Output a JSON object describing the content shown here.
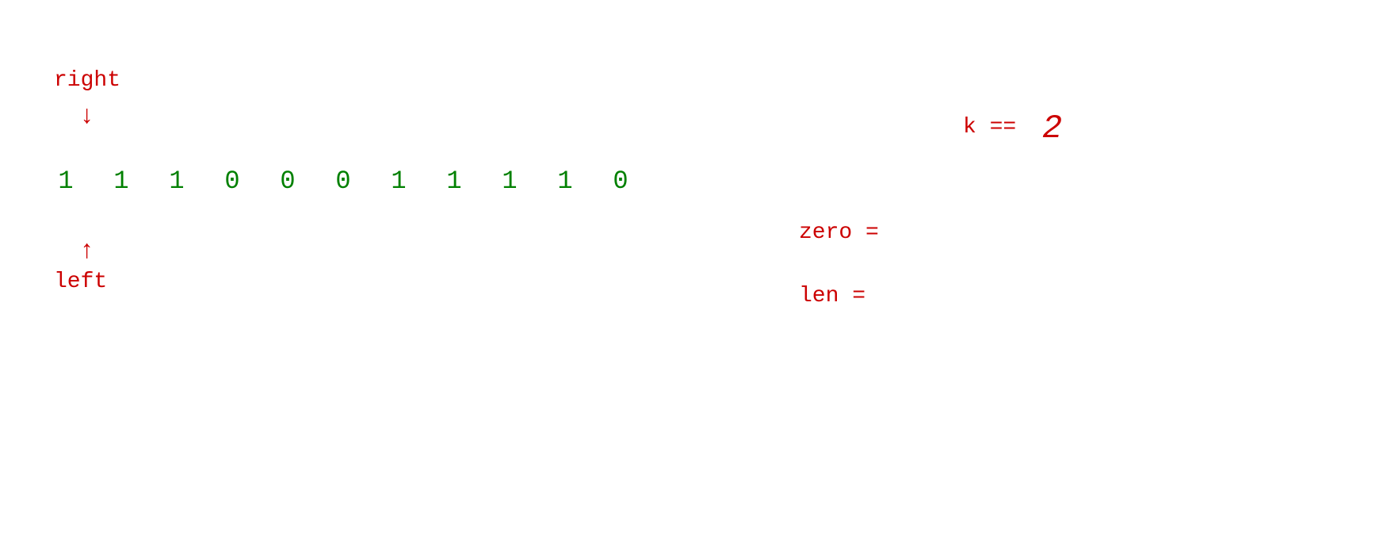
{
  "right_label": "right",
  "right_arrow": "↓",
  "left_arrow": "↑",
  "left_label": "left",
  "array": {
    "values": [
      "1",
      "1",
      "1",
      "0",
      "0",
      "0",
      "1",
      "1",
      "1",
      "1",
      "0"
    ]
  },
  "k_label": "k ==",
  "k_value": "2",
  "zero_label": "zero =",
  "len_label": "len ="
}
